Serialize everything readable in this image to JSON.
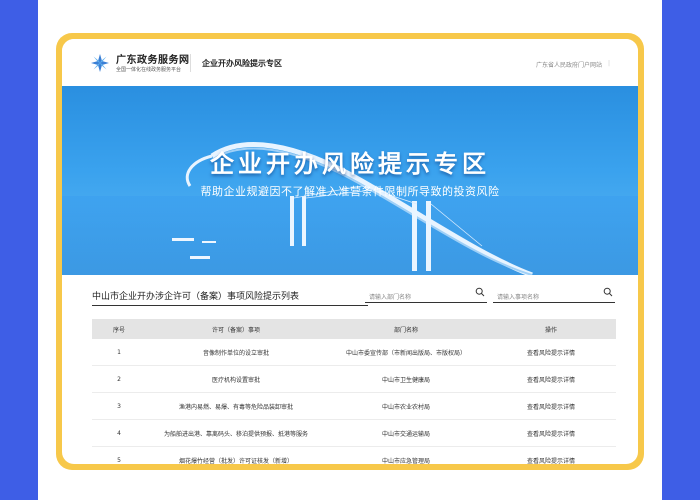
{
  "header": {
    "site_name": "广东政务服务网",
    "site_sub": "全国一体化在线政务服务平台",
    "page_title": "企业开办风险提示专区",
    "portal_link": "广东省人民政府门户网站",
    "separator": "|"
  },
  "banner": {
    "title": "企业开办风险提示专区",
    "subtitle": "帮助企业规避因不了解准入准营条件限制所导致的投资风险"
  },
  "section": {
    "title": "中山市企业开办涉企许可（备案）事项风险提示列表"
  },
  "search": {
    "dept_placeholder": "请输入部门名称",
    "item_placeholder": "请输入事项名称"
  },
  "table": {
    "headers": [
      "序号",
      "许可（备案）事项",
      "部门名称",
      "操作"
    ],
    "rows": [
      [
        "1",
        "音像制作单位的设立审批",
        "中山市委宣传部（市新闻出版局、市版权局）",
        "查看风险提示详情"
      ],
      [
        "2",
        "医疗机构设置审批",
        "中山市卫生健康局",
        "查看风险提示详情"
      ],
      [
        "3",
        "渔港内易燃、易爆、有毒等危险品装卸审批",
        "中山市农业农村局",
        "查看风险提示详情"
      ],
      [
        "4",
        "为船舶进出港、靠离码头、移泊提供预报、抵港等服务",
        "中山市交通运输局",
        "查看风险提示详情"
      ],
      [
        "5",
        "烟花爆竹经营（批发）许可证核发（新增）",
        "中山市应急管理局",
        "查看风险提示详情"
      ]
    ]
  },
  "colors": {
    "side": "#3e5ee6",
    "frame": "#f7c84a",
    "banner": "#2a8fe0"
  },
  "icons": {
    "logo": "gd-logo-icon",
    "search": "search-icon"
  }
}
